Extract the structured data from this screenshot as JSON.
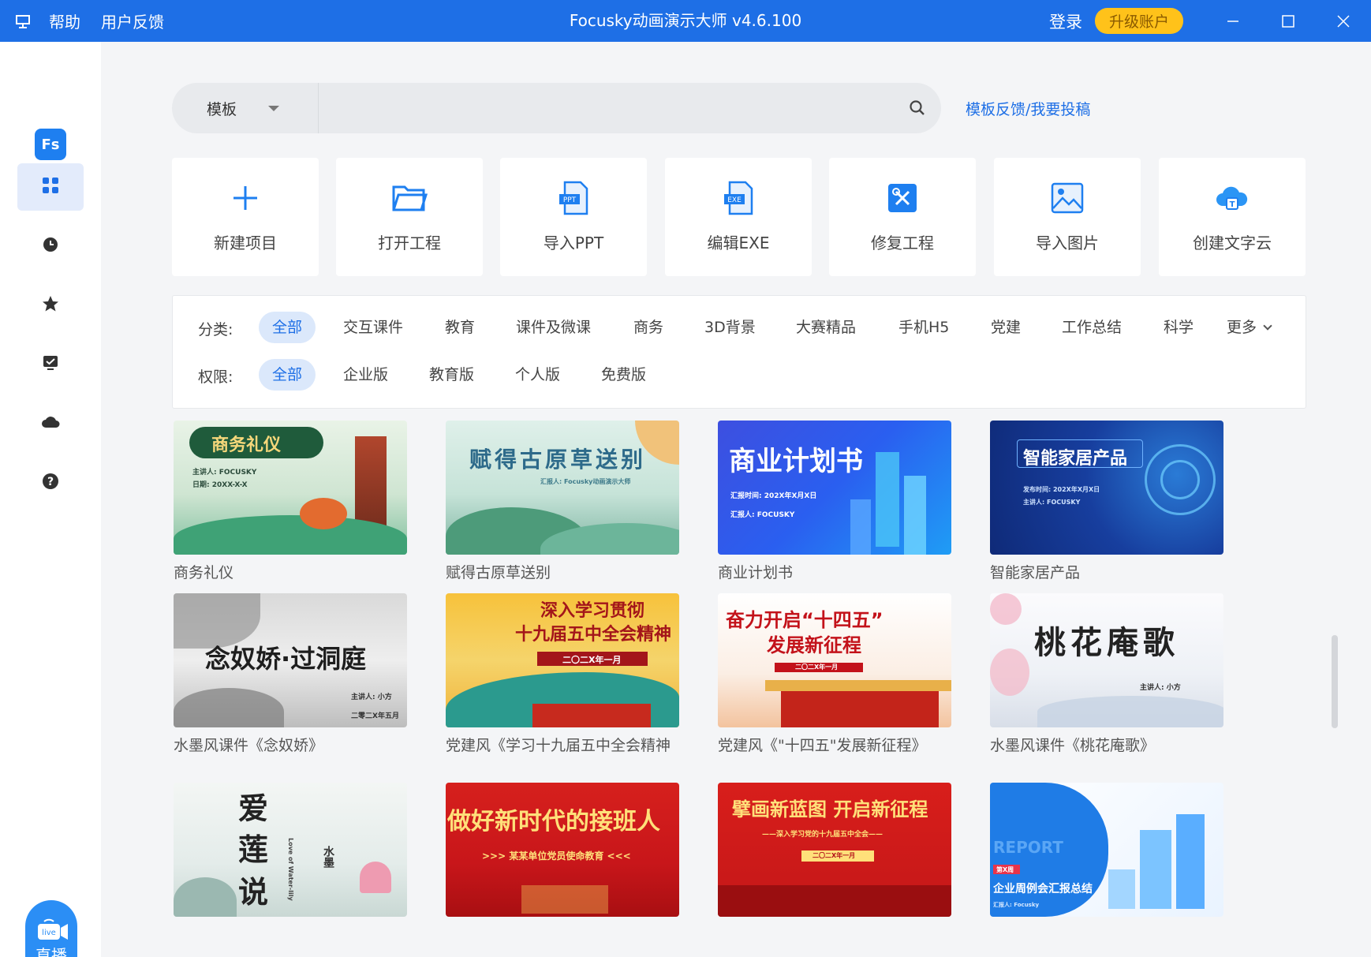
{
  "titlebar": {
    "menu": [
      "帮助",
      "用户反馈"
    ],
    "title": "Focusky动画演示大师 v4.6.100",
    "login": "登录",
    "upgrade": "升级账户"
  },
  "sidebar": {
    "logo": "Fs",
    "items": [
      "templates-icon",
      "recent-icon",
      "favorites-icon",
      "presentation-icon",
      "cloud-icon",
      "help-icon"
    ],
    "live_label": "直播",
    "live_badge": "live"
  },
  "search": {
    "type": "模板",
    "placeholder": "",
    "feedback": "模板反馈/我要投稿"
  },
  "actions": [
    {
      "label": "新建项目",
      "icon": "plus-icon"
    },
    {
      "label": "打开工程",
      "icon": "folder-icon"
    },
    {
      "label": "导入PPT",
      "icon": "ppt-file-icon"
    },
    {
      "label": "编辑EXE",
      "icon": "exe-file-icon"
    },
    {
      "label": "修复工程",
      "icon": "repair-icon"
    },
    {
      "label": "导入图片",
      "icon": "image-icon"
    },
    {
      "label": "创建文字云",
      "icon": "word-cloud-icon"
    }
  ],
  "filters": {
    "category_label": "分类:",
    "categories": [
      "全部",
      "交互课件",
      "教育",
      "课件及微课",
      "商务",
      "3D背景",
      "大赛精品",
      "手机H5",
      "党建",
      "工作总结",
      "科学",
      "更多"
    ],
    "permission_label": "权限:",
    "permissions": [
      "全部",
      "企业版",
      "教育版",
      "个人版",
      "免费版"
    ]
  },
  "templates": [
    {
      "title": "商务礼仪",
      "thumb": [
        "商务礼仪",
        "主讲人: FOCUSKY",
        "日期: 20XX-X-X"
      ]
    },
    {
      "title": "赋得古原草送别",
      "thumb": [
        "赋得古原草送别",
        "汇报人: Focusky动画演示大师"
      ]
    },
    {
      "title": "商业计划书",
      "thumb": [
        "商业计划书",
        "汇报时间: 202X年X月X日",
        "汇报人: FOCUSKY"
      ]
    },
    {
      "title": "智能家居产品",
      "thumb": [
        "智能家居产品",
        "发布时间: 202X年X月X日",
        "主讲人: FOCUSKY"
      ]
    },
    {
      "title": "水墨风课件《念奴娇》",
      "thumb": [
        "念奴娇·过洞庭",
        "主讲人: 小方",
        "二零二X年五月"
      ]
    },
    {
      "title": "党建风《学习十九届五中全会精神",
      "thumb": [
        "深入学习贯彻",
        "十九届五中全会精神",
        "二〇二X年一月"
      ]
    },
    {
      "title": "党建风《\"十四五\"发展新征程》",
      "thumb": [
        "奋力开启“十四五”",
        "发展新征程",
        "二〇二X年一月"
      ]
    },
    {
      "title": "水墨风课件《桃花庵歌》",
      "thumb": [
        "桃花庵歌",
        "主讲人: 小方"
      ]
    },
    {
      "title": "",
      "thumb": [
        "爱",
        "莲",
        "说",
        "水墨",
        "Love of Water-lily"
      ]
    },
    {
      "title": "",
      "thumb": [
        "做好新时代的接班人",
        ">>> 某某单位党员使命教育 <<<"
      ]
    },
    {
      "title": "",
      "thumb": [
        "擘画新蓝图 开启新征程",
        "——深入学习党的十九届五中全会——",
        "二〇二X年一月"
      ]
    },
    {
      "title": "",
      "thumb": [
        "REPORT",
        "第X周",
        "企业周例会汇报总结",
        "汇报人: Focusky"
      ]
    }
  ]
}
